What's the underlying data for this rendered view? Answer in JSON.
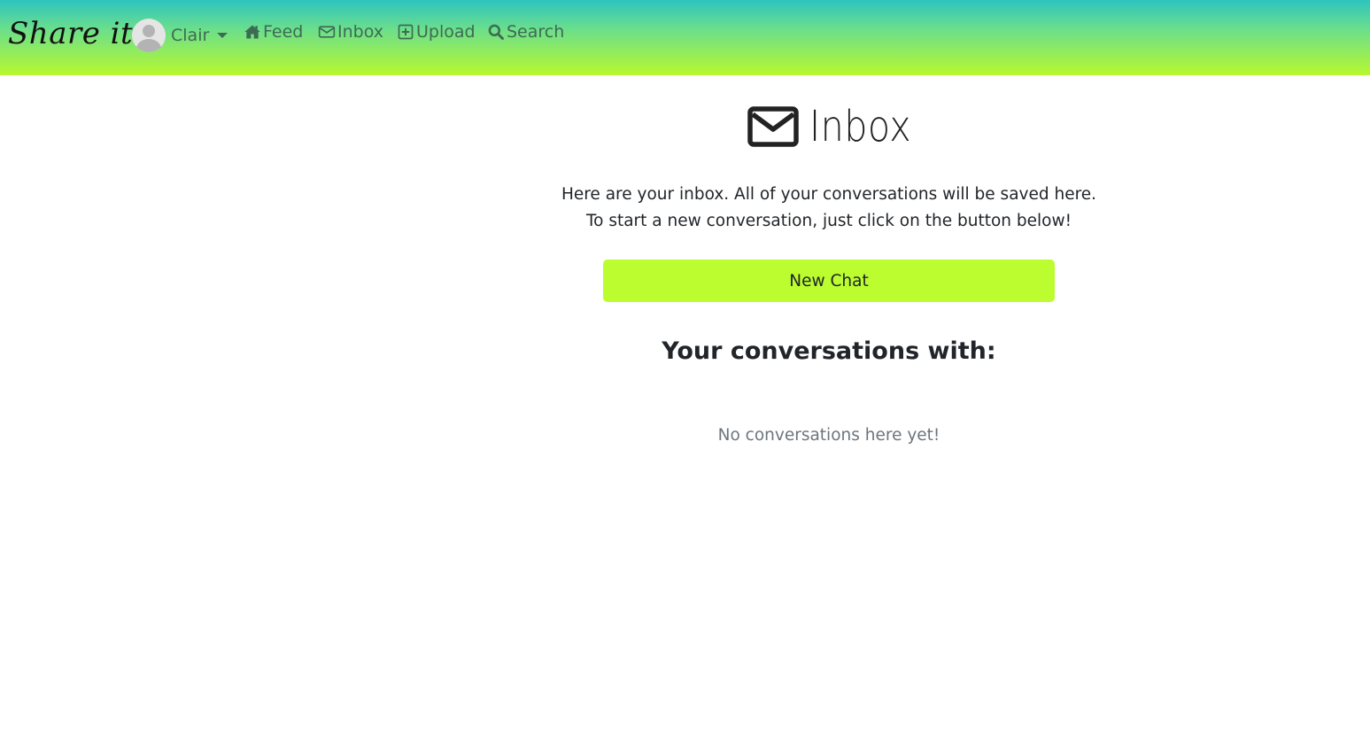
{
  "navbar": {
    "brand": "Share it",
    "user": {
      "name": "Clair"
    },
    "links": [
      {
        "label": "Feed",
        "icon": "home-icon"
      },
      {
        "label": "Inbox",
        "icon": "envelope-icon"
      },
      {
        "label": "Upload",
        "icon": "plus-square-icon"
      },
      {
        "label": "Search",
        "icon": "search-icon"
      }
    ],
    "colors": {
      "gradient_top": "#2ec4c0",
      "gradient_bottom": "#b8f82e",
      "link": "#3d6a55"
    }
  },
  "main": {
    "title": "Inbox",
    "title_icon": "envelope-icon",
    "intro_line1": "Here are your inbox. All of your conversations will be saved here.",
    "intro_line2": "To start a new conversation, just click on the button below!",
    "new_chat_label": "New Chat",
    "conversations_heading": "Your conversations with:",
    "empty_message": "No conversations here yet!",
    "colors": {
      "button": "#bbfd2f",
      "muted": "#6c757d"
    }
  }
}
